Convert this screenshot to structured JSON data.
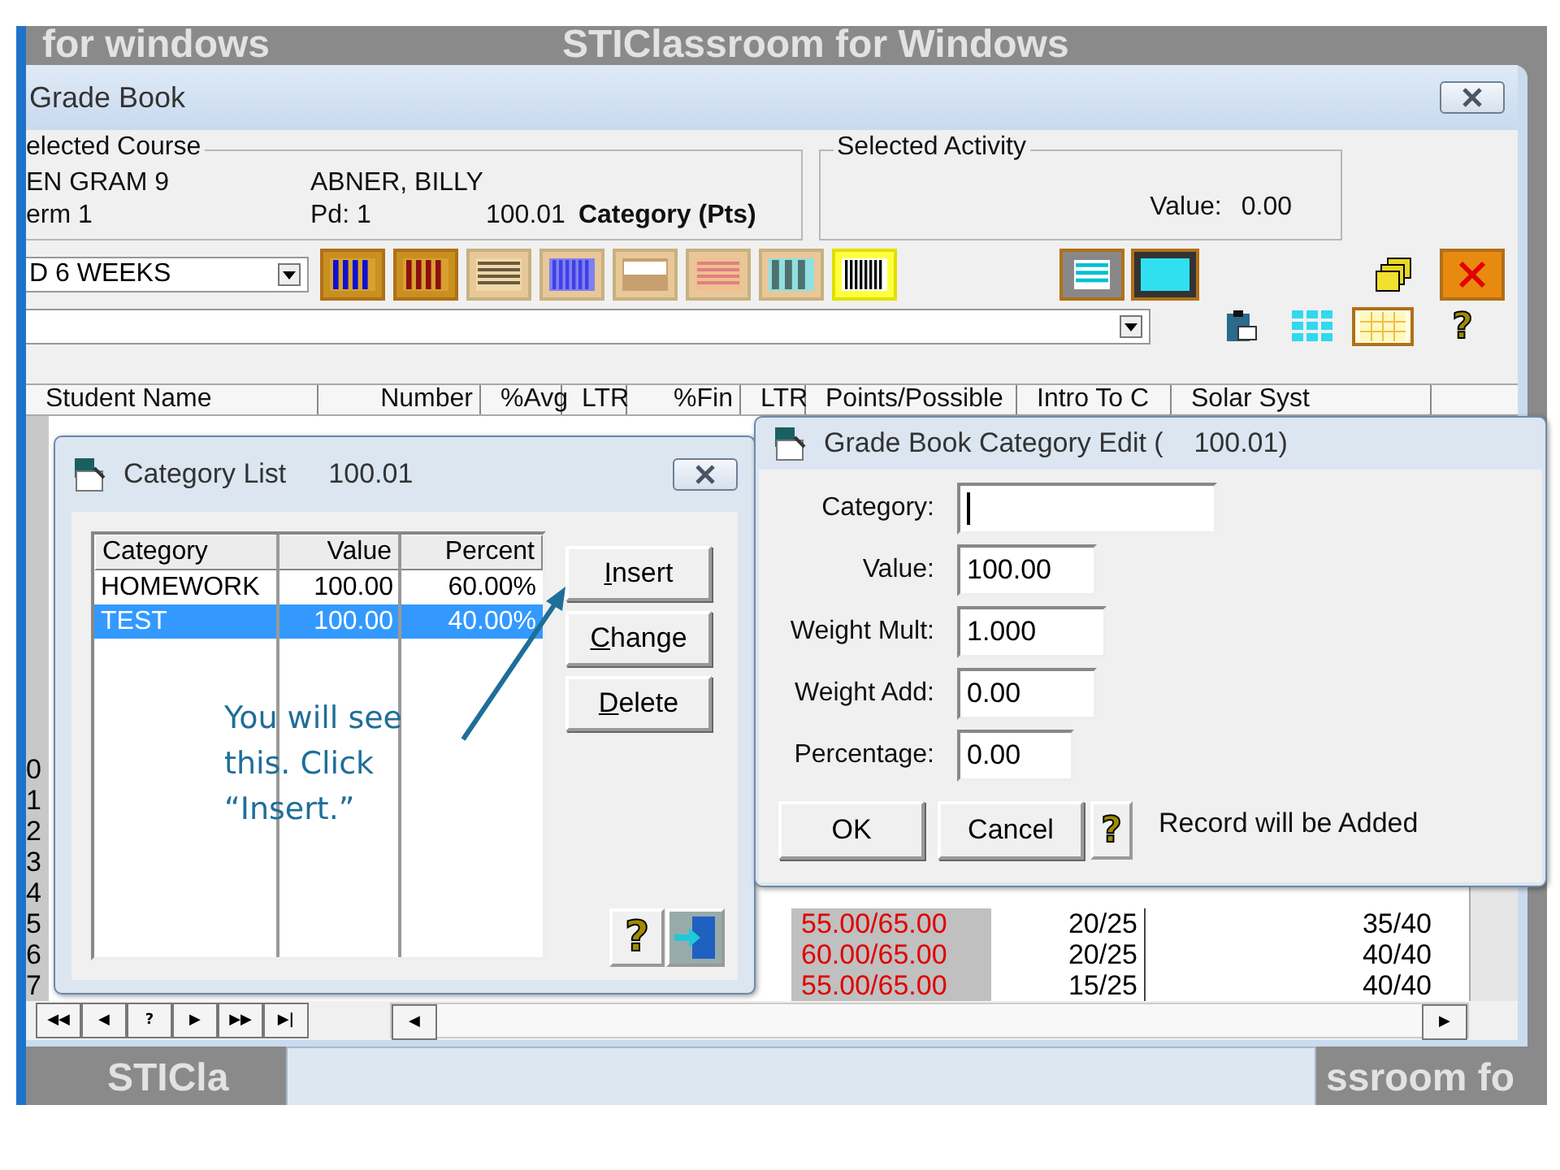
{
  "desktop": {
    "logo_texts": [
      "for windows",
      "STIClassroom for Windows",
      "STICla",
      "ssroom fo"
    ]
  },
  "main_window": {
    "title": "Grade Book",
    "selected_course": {
      "legend": "elected Course",
      "course": "EN GRAM 9",
      "term": "erm 1",
      "student": "ABNER, BILLY",
      "period": "Pd: 1",
      "number": "100.01",
      "category": "Category (Pts)"
    },
    "selected_activity": {
      "legend": "Selected Activity",
      "value_label": "Value:",
      "value": "0.00"
    },
    "grading_period": "D 6 WEEKS",
    "help_glyph": "?",
    "grid": {
      "columns": [
        "Student Name",
        "Number",
        "%Avg",
        "LTR",
        "%Fin",
        "LTR",
        "Points/Possible",
        "Intro To C",
        "Solar Syst"
      ],
      "row_numbers": [
        "0",
        "1",
        "2",
        "3",
        "4",
        "5",
        "6",
        "7"
      ],
      "rows": [
        {
          "points": "55.00/65.00",
          "intro": "20/25",
          "solar": "35/40"
        },
        {
          "points": "60.00/65.00",
          "intro": "20/25",
          "solar": "40/40"
        },
        {
          "points": "55.00/65.00",
          "intro": "15/25",
          "solar": "40/40"
        }
      ]
    },
    "nav_buttons": [
      "◀◀",
      "◀",
      "?",
      "▶",
      "▶▶",
      "▶|"
    ]
  },
  "category_list": {
    "title": "Category List",
    "course_number": "100.01",
    "columns": [
      "Category",
      "Value",
      "Percent"
    ],
    "rows": [
      {
        "category": "HOMEWORK",
        "value": "100.00",
        "percent": "60.00%",
        "selected": false
      },
      {
        "category": "TEST",
        "value": "100.00",
        "percent": "40.00%",
        "selected": true
      }
    ],
    "buttons": [
      "Insert",
      "Change",
      "Delete"
    ],
    "help_glyph": "?"
  },
  "category_edit": {
    "title": "Grade Book Category Edit (    100.01)",
    "fields": [
      {
        "label": "Category:",
        "focused": true
      },
      {
        "label": "Value:",
        "value": "100.00",
        "focused": false
      },
      {
        "label": "Weight Mult:",
        "value": "1.000",
        "focused": false
      },
      {
        "label": "Weight Add:",
        "value": "0.00",
        "focused": false
      },
      {
        "label": "Percentage:",
        "value": "0.00",
        "focused": false
      }
    ],
    "buttons": [
      "OK",
      "Cancel"
    ],
    "help_glyph": "?",
    "message": "Record will be Added"
  },
  "callout": {
    "text": "You will see this. Click “Insert.”"
  }
}
